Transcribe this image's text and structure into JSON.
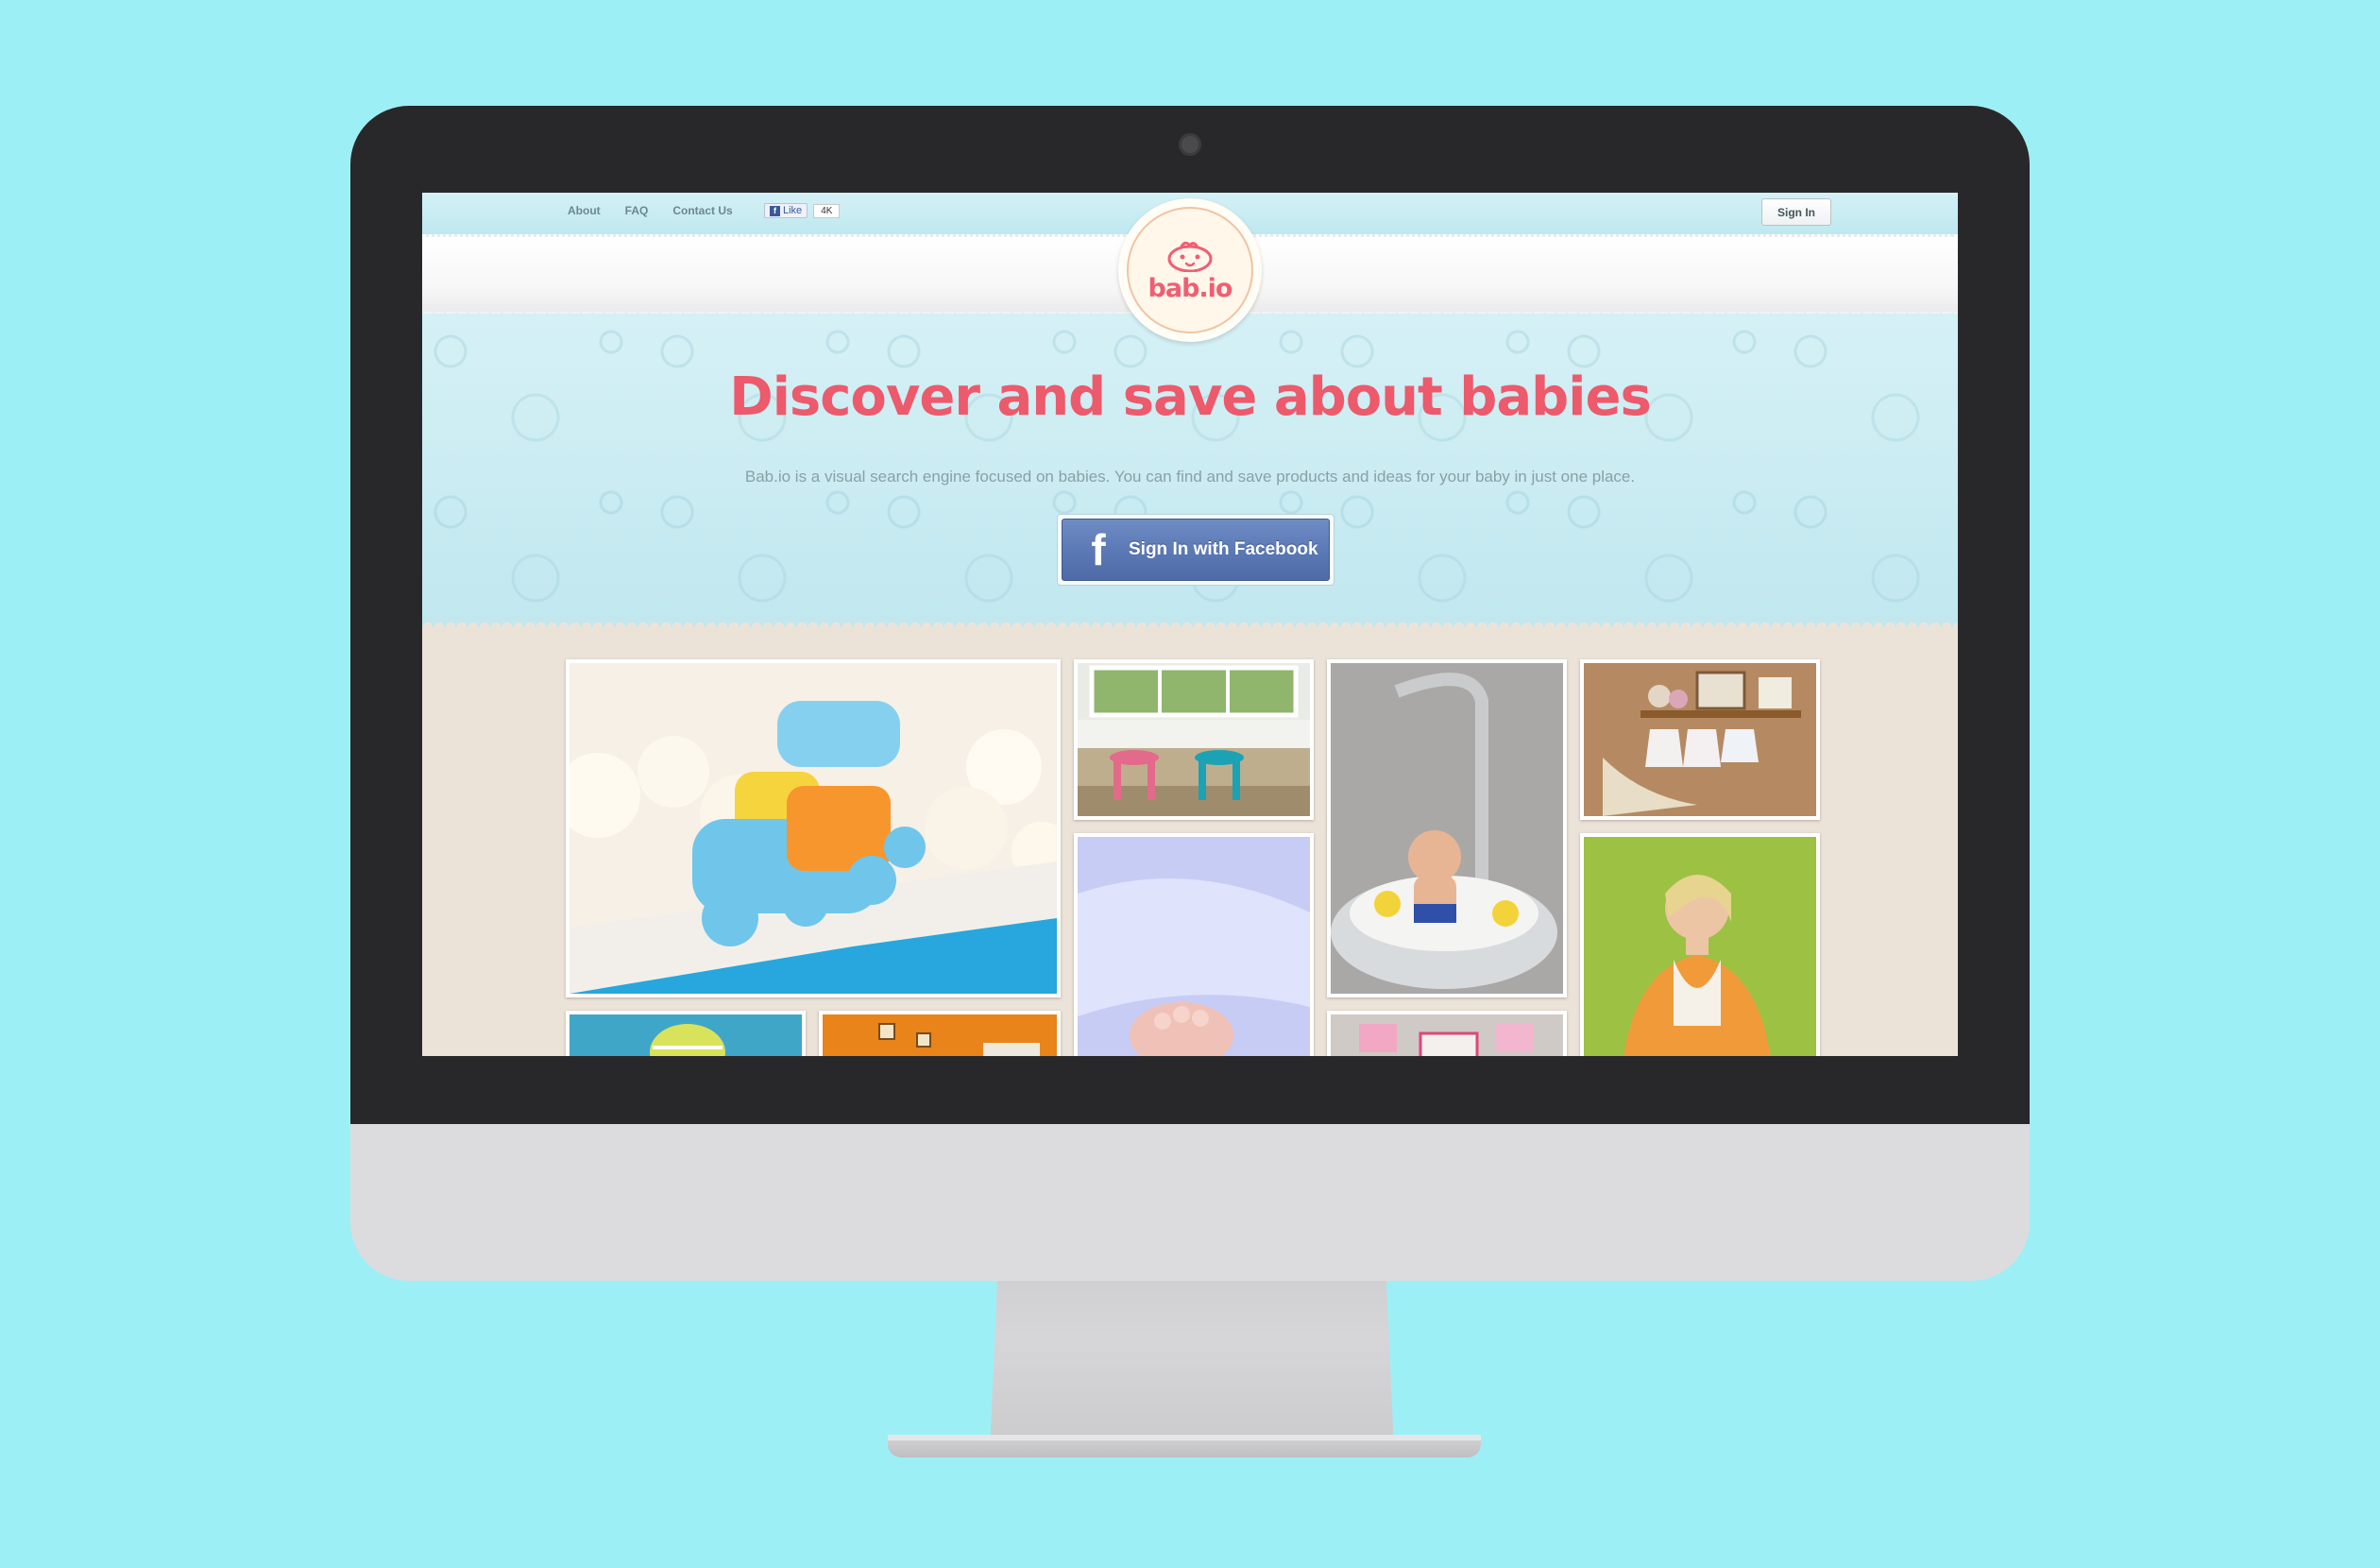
{
  "nav": {
    "about": "About",
    "faq": "FAQ",
    "contact": "Contact Us",
    "like_label": "Like",
    "like_count": "4K",
    "signin_label": "Sign In"
  },
  "logo": {
    "text": "bab.io"
  },
  "hero": {
    "title": "Discover and save about babies",
    "subtitle": "Bab.io  is a visual search engine focused on babies. You can find and save products and ideas for your baby in just one place.",
    "facebook_button": "Sign In with Facebook"
  },
  "colors": {
    "background": "#9deff6",
    "title_pink": "#ec5a6c",
    "facebook_blue": "#5a78b4"
  },
  "photos": [
    {
      "name": "toy-train-cake-photo"
    },
    {
      "name": "kids-stools-window-photo"
    },
    {
      "name": "baby-bath-cake-photo"
    },
    {
      "name": "nursery-shelf-onesies-photo"
    },
    {
      "name": "baby-feet-blanket-photo"
    },
    {
      "name": "pregnant-woman-photo"
    },
    {
      "name": "knit-hat-photo"
    },
    {
      "name": "orange-nursery-photo"
    },
    {
      "name": "baby-cookies-photo"
    }
  ]
}
